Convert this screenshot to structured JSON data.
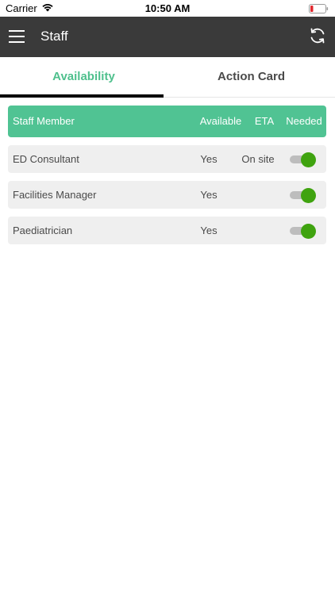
{
  "status_bar": {
    "carrier": "Carrier",
    "time": "10:50 AM"
  },
  "nav": {
    "title": "Staff"
  },
  "tabs": [
    {
      "label": "Availability",
      "active": true
    },
    {
      "label": "Action Card",
      "active": false
    }
  ],
  "table": {
    "headers": {
      "name": "Staff Member",
      "available": "Available",
      "eta": "ETA",
      "needed": "Needed"
    },
    "rows": [
      {
        "name": "ED Consultant",
        "available": "Yes",
        "eta": "On site",
        "needed": true
      },
      {
        "name": "Facilities Manager",
        "available": "Yes",
        "eta": "",
        "needed": true
      },
      {
        "name": "Paediatrician",
        "available": "Yes",
        "eta": "",
        "needed": true
      }
    ]
  },
  "colors": {
    "accent_green": "#50c393",
    "toggle_on": "#3fa30f",
    "nav_background": "#3a3a3a",
    "battery_low": "#e0282e"
  },
  "icons": {
    "menu": "hamburger-menu-icon",
    "refresh": "refresh-icon",
    "wifi": "wifi-icon",
    "battery": "battery-icon"
  }
}
